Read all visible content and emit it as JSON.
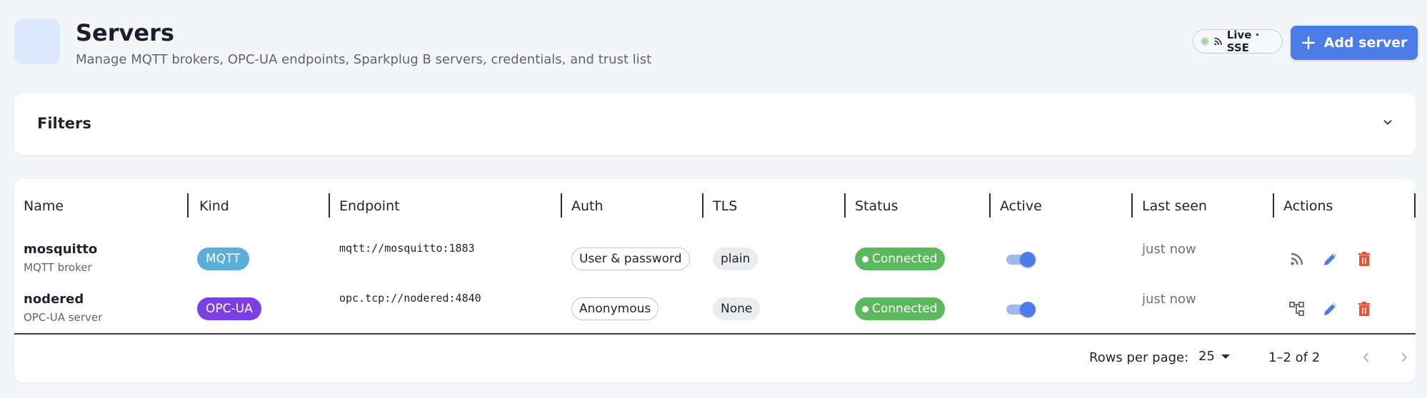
{
  "header": {
    "title": "Servers",
    "subtitle": "Manage MQTT brokers, OPC-UA endpoints, Sparkplug B servers, credentials, and trust list",
    "live_label": "Live · SSE",
    "add_label": "Add server"
  },
  "filters": {
    "title": "Filters"
  },
  "table": {
    "columns": [
      "Name",
      "Kind",
      "Endpoint",
      "Auth",
      "TLS",
      "Status",
      "Active",
      "Last seen",
      "Actions"
    ],
    "rows": [
      {
        "name": "mosquitto",
        "subtitle": "MQTT broker",
        "kind": "MQTT",
        "kind_color": "#5aaed8",
        "endpoint": "mqtt://mosquitto:1883",
        "auth": "User & password",
        "tls": "plain",
        "status": "Connected",
        "active": true,
        "last_seen": "just now",
        "primary_action_icon": "rss-icon"
      },
      {
        "name": "nodered",
        "subtitle": "OPC-UA server",
        "kind": "OPC-UA",
        "kind_color": "#7b3fe4",
        "endpoint": "opc.tcp://nodered:4840",
        "auth": "Anonymous",
        "tls": "None",
        "status": "Connected",
        "active": true,
        "last_seen": "just now",
        "primary_action_icon": "tree-icon"
      }
    ]
  },
  "pagination": {
    "rows_per_page_label": "Rows per page:",
    "rows_per_page": "25",
    "range": "1–2 of 2"
  },
  "colors": {
    "accent": "#4c7ce8",
    "success": "#5cb85c",
    "danger": "#e4533a",
    "muted_icon": "#6b707c"
  }
}
